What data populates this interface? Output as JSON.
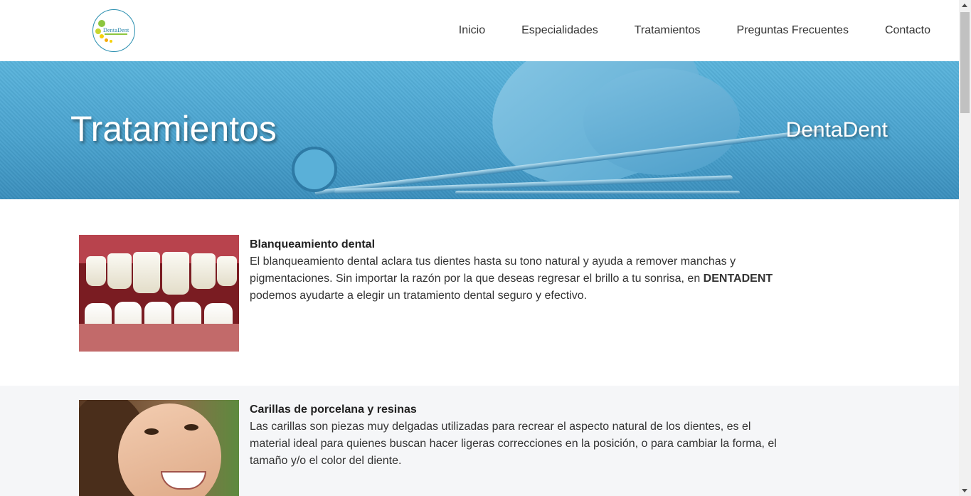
{
  "brand": {
    "logo_text": "DentaDent"
  },
  "nav": {
    "items": [
      "Inicio",
      "Especialidades",
      "Tratamientos",
      "Preguntas Frecuentes",
      "Contacto"
    ]
  },
  "banner": {
    "title": "Tratamientos",
    "brand": "DentaDent"
  },
  "treatments": [
    {
      "title": "Blanqueamiento dental",
      "text_before": "El blanqueamiento dental aclara tus dientes hasta su tono natural y ayuda a remover manchas y pigmentaciones. Sin importar la razón por la que deseas regresar el brillo a tu sonrisa, en ",
      "text_bold": "DENTADENT",
      "text_after": " podemos ayudarte a elegir un tratamiento dental seguro y efectivo."
    },
    {
      "title": "Carillas de porcelana y resinas",
      "text": "Las carillas son piezas muy delgadas utilizadas para recrear el aspecto natural de los dientes, es el material ideal para quienes buscan hacer ligeras correcciones en la posición, o para cambiar la forma, el tamaño y/o el color del diente."
    }
  ],
  "colors": {
    "banner_blue": "#4aa3cf",
    "section_alt_bg": "#f5f6f8",
    "text": "#333333"
  }
}
